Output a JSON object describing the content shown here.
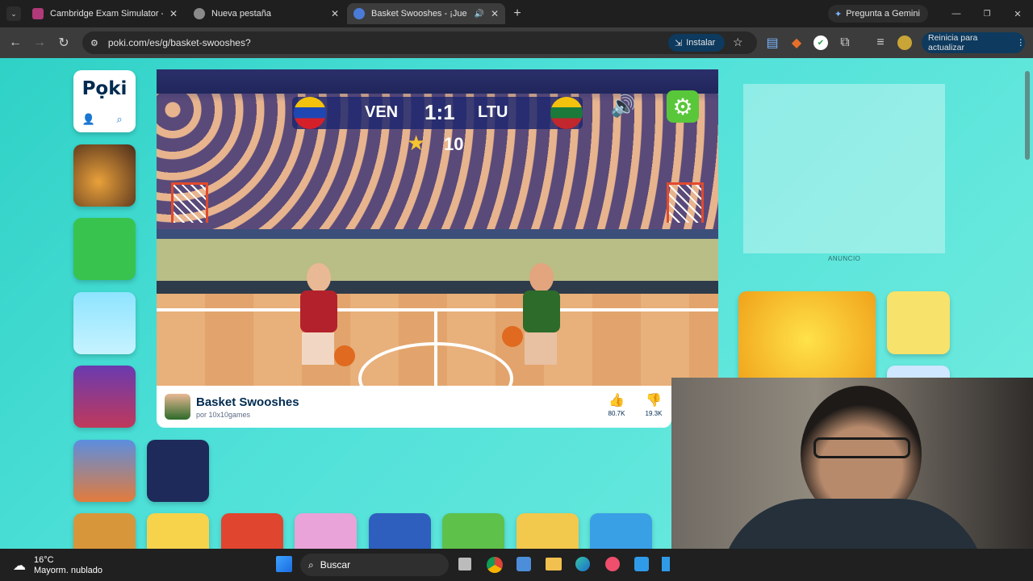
{
  "tabs": [
    {
      "title": "Cambridge Exam Simulator - Er",
      "color": "#b03a7a"
    },
    {
      "title": "Nueva pestaña",
      "color": "#8a8a8a"
    },
    {
      "title": "Basket Swooshes - ¡Juega G",
      "color": "#4a7bd8"
    }
  ],
  "gemini": "Pregunta a Gemini",
  "url": "poki.com/es/g/basket-swooshes?",
  "install_label": "Instalar",
  "update_label": "Reinicia para actualizar",
  "scoreboard": {
    "home": "VEN",
    "away": "LTU",
    "score": "1:1",
    "stars": "10"
  },
  "game": {
    "title": "Basket Swooshes",
    "author": "por 10x10games",
    "likes": "80.7K",
    "dislikes": "19.3K"
  },
  "ad_label": "ANUNCIO",
  "taskbar": {
    "temp": "16°C",
    "weather": "Mayorm. nublado",
    "search": "Buscar"
  },
  "colors": {
    "accent": "#2fd1c6",
    "poki_blue": "#002b50",
    "settings_green": "#59c73a"
  }
}
